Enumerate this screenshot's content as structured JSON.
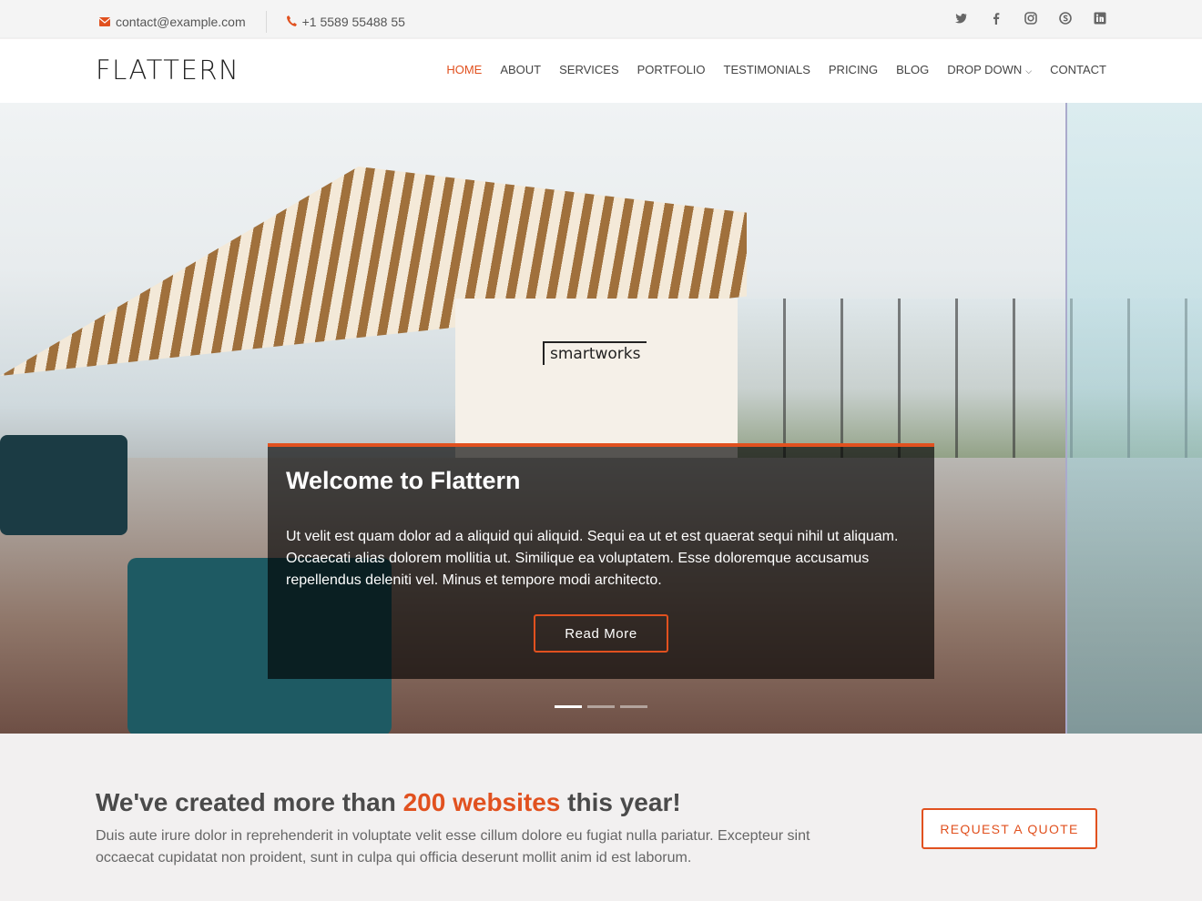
{
  "topbar": {
    "email": "contact@example.com",
    "phone": "+1 5589 55488 55",
    "social_icons": [
      "twitter-icon",
      "facebook-icon",
      "instagram-icon",
      "skype-icon",
      "linkedin-icon"
    ]
  },
  "header": {
    "logo": "FLATTERN",
    "nav": {
      "home": "HOME",
      "about": "ABOUT",
      "services": "SERVICES",
      "portfolio": "PORTFOLIO",
      "testimonials": "TESTIMONIALS",
      "pricing": "PRICING",
      "blog": "BLOG",
      "dropdown": "DROP DOWN",
      "contact": "CONTACT"
    }
  },
  "hero": {
    "sign": "smartworks",
    "title": "Welcome to Flattern",
    "text": "Ut velit est quam dolor ad a aliquid qui aliquid. Sequi ea ut et est quaerat sequi nihil ut aliquam. Occaecati alias dolorem mollitia ut. Similique ea voluptatem. Esse doloremque accusamus repellendus deleniti vel. Minus et tempore modi architecto.",
    "button": "Read More",
    "slides": 3,
    "active_slide": 1
  },
  "cta": {
    "heading_before": "We've created more than ",
    "heading_highlight": "200 websites",
    "heading_after": " this year!",
    "text": "Duis aute irure dolor in reprehenderit in voluptate velit esse cillum dolore eu fugiat nulla pariatur. Excepteur sint occaecat cupidatat non proident, sunt in culpa qui officia deserunt mollit anim id est laborum.",
    "button": "REQUEST A QUOTE"
  },
  "colors": {
    "accent": "#e1511f"
  }
}
